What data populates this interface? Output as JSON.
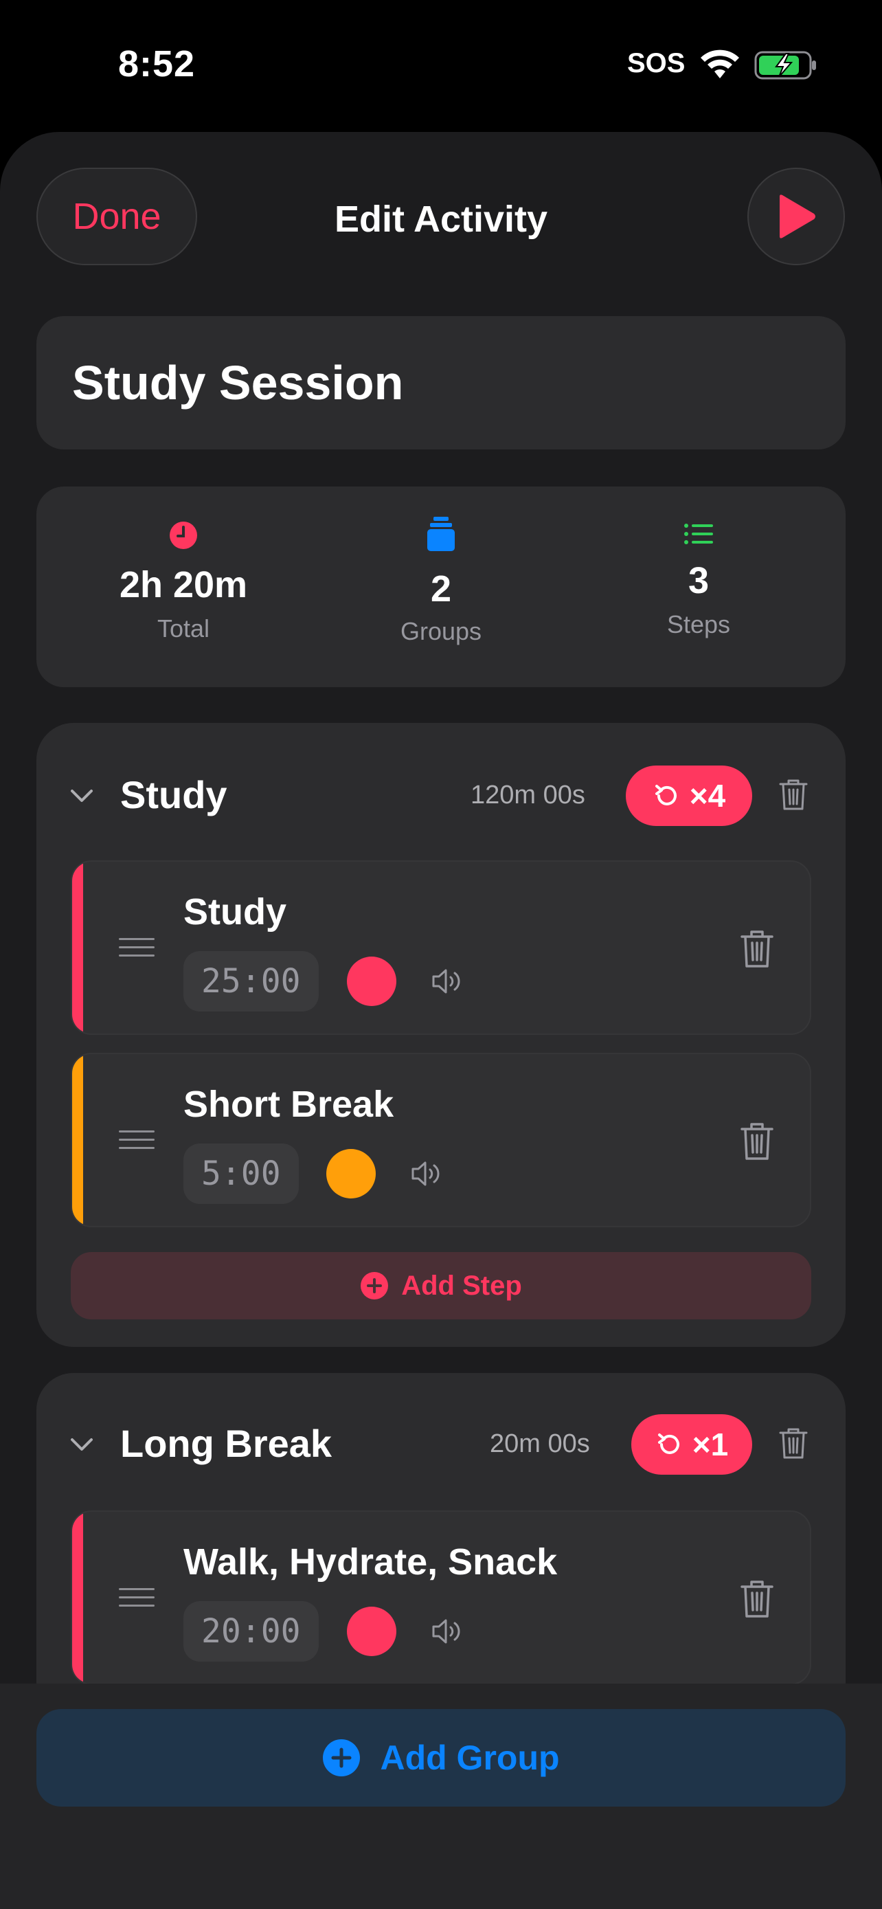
{
  "status_bar": {
    "time": "8:52",
    "carrier": "SOS"
  },
  "nav": {
    "done_label": "Done",
    "title": "Edit Activity"
  },
  "activity": {
    "title": "Study Session"
  },
  "stats": [
    {
      "value": "2h 20m",
      "label": "Total",
      "icon": "clock-icon",
      "color": "#ff375f"
    },
    {
      "value": "2",
      "label": "Groups",
      "icon": "stack-icon",
      "color": "#0a84ff"
    },
    {
      "value": "3",
      "label": "Steps",
      "icon": "list-icon",
      "color": "#30d158"
    }
  ],
  "groups": [
    {
      "name": "Study",
      "duration": "120m 00s",
      "repeat": "×4",
      "steps": [
        {
          "name": "Study",
          "time": "25:00",
          "color": "#ff375f"
        },
        {
          "name": "Short Break",
          "time": "5:00",
          "color": "#ff9f0a"
        }
      ],
      "add_step_label": "Add Step"
    },
    {
      "name": "Long Break",
      "duration": "20m 00s",
      "repeat": "×1",
      "steps": [
        {
          "name": "Walk, Hydrate, Snack",
          "time": "20:00",
          "color": "#ff375f"
        }
      ]
    }
  ],
  "footer": {
    "add_group_label": "Add Group"
  },
  "colors": {
    "accent_red": "#ff375f",
    "accent_blue": "#0a84ff",
    "accent_orange": "#ff9f0a",
    "accent_green": "#30d158"
  }
}
